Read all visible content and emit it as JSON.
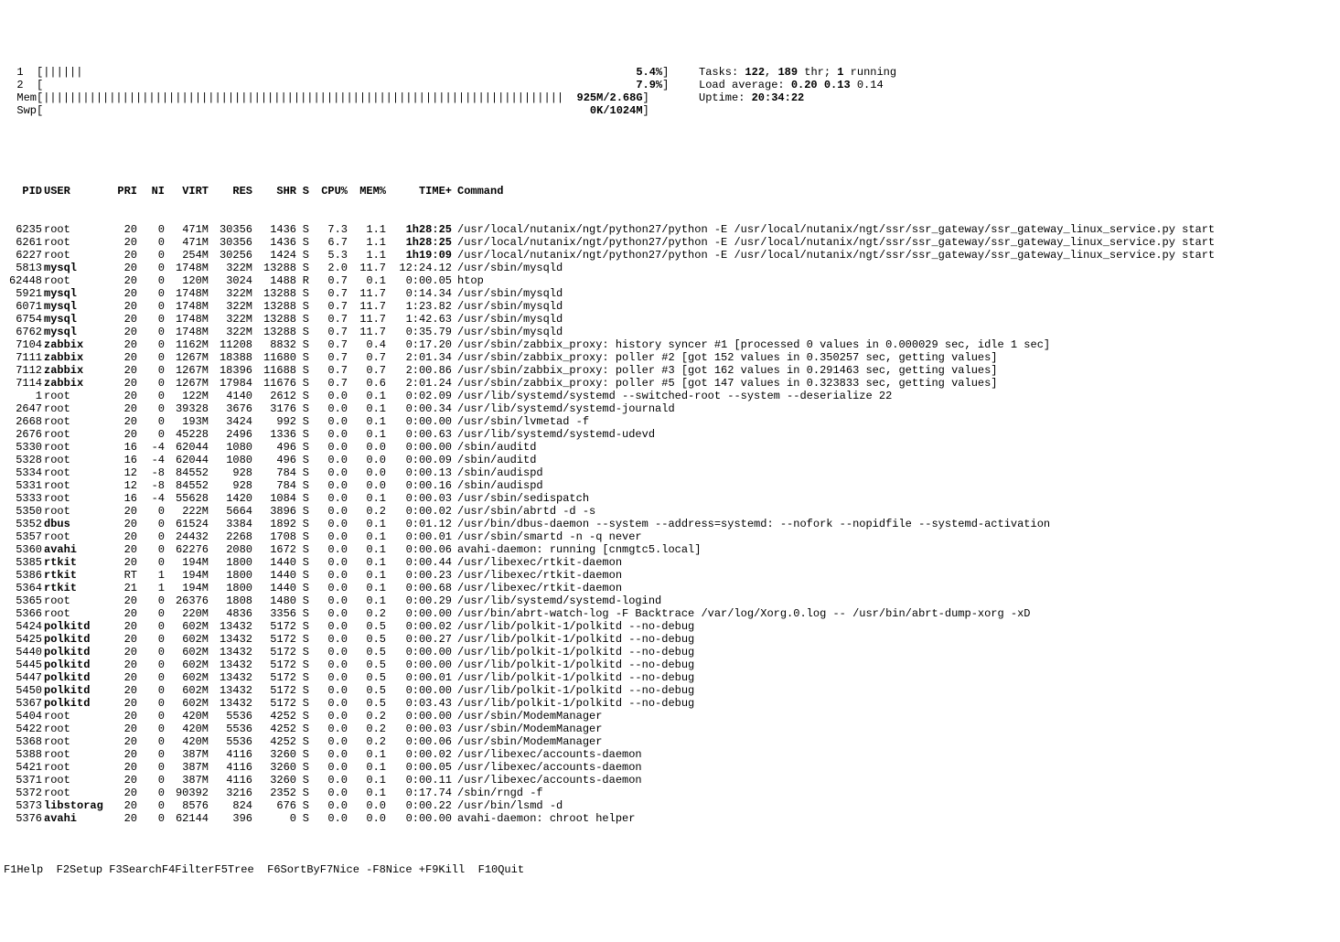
{
  "meters": {
    "cpu1": {
      "label": "  1  ",
      "bar": "[||||||                                                                                    ",
      "pct": "5.4%",
      "close": "]"
    },
    "cpu2": {
      "label": "  2  ",
      "bar": "[                                                                                          ",
      "pct": "7.9%",
      "close": "]"
    },
    "mem": {
      "label": "  Mem",
      "bar": "[|||||||||||||||||||||||||||||||||||||||||||||||||||||||||||||||||||||||||||||||  ",
      "val": "925M/2.68G",
      "close": "]"
    },
    "swp": {
      "label": "  Swp",
      "bar": "[                                                                                   ",
      "val": "0K/1024M",
      "close": "]"
    }
  },
  "stats": {
    "tasks_label": "Tasks: ",
    "tasks_a": "122",
    "tasks_sep1": ", ",
    "tasks_b": "189",
    "tasks_thr": " thr; ",
    "tasks_c": "1",
    "tasks_run": " running",
    "load_label": "Load average: ",
    "load_a": "0.20",
    "load_b": " 0.13",
    "load_c": " 0.14",
    "uptime_label": "Uptime: ",
    "uptime_val": "20:34:22"
  },
  "columns": [
    "PID",
    "USER",
    "PRI",
    "NI",
    "VIRT",
    "RES",
    "SHR",
    "S",
    "CPU%",
    "MEM%",
    "TIME+",
    "Command"
  ],
  "rows": [
    {
      "pid": "6235",
      "user": "root",
      "ub": false,
      "pri": "20",
      "ni": "0",
      "virt": "471M",
      "res": "30356",
      "shr": "1436",
      "s": "S",
      "cpu": "7.3",
      "mem": "1.1",
      "time": "1h28:25",
      "tb": true,
      "cmd": "/usr/local/nutanix/ngt/python27/python -E /usr/local/nutanix/ngt/ssr/ssr_gateway/ssr_gateway_linux_service.py start"
    },
    {
      "pid": "6261",
      "user": "root",
      "ub": false,
      "pri": "20",
      "ni": "0",
      "virt": "471M",
      "res": "30356",
      "shr": "1436",
      "s": "S",
      "cpu": "6.7",
      "mem": "1.1",
      "time": "1h28:25",
      "tb": true,
      "cmd": "/usr/local/nutanix/ngt/python27/python -E /usr/local/nutanix/ngt/ssr/ssr_gateway/ssr_gateway_linux_service.py start"
    },
    {
      "pid": "6227",
      "user": "root",
      "ub": false,
      "pri": "20",
      "ni": "0",
      "virt": "254M",
      "res": "30256",
      "shr": "1424",
      "s": "S",
      "cpu": "5.3",
      "mem": "1.1",
      "time": "1h19:09",
      "tb": true,
      "cmd": "/usr/local/nutanix/ngt/python27/python -E /usr/local/nutanix/ngt/ssr/ssr_gateway/ssr_gateway_linux_service.py start"
    },
    {
      "pid": "5813",
      "user": "mysql",
      "ub": true,
      "pri": "20",
      "ni": "0",
      "virt": "1748M",
      "res": "322M",
      "shr": "13288",
      "s": "S",
      "cpu": "2.0",
      "mem": "11.7",
      "time": "12:24.12",
      "tb": false,
      "cmd": "/usr/sbin/mysqld"
    },
    {
      "pid": "62448",
      "user": "root",
      "ub": false,
      "pri": "20",
      "ni": "0",
      "virt": "120M",
      "res": "3024",
      "shr": "1488",
      "s": "R",
      "cpu": "0.7",
      "mem": "0.1",
      "time": "0:00.05",
      "tb": false,
      "cmd": "htop"
    },
    {
      "pid": "5921",
      "user": "mysql",
      "ub": true,
      "pri": "20",
      "ni": "0",
      "virt": "1748M",
      "res": "322M",
      "shr": "13288",
      "s": "S",
      "cpu": "0.7",
      "mem": "11.7",
      "time": "0:14.34",
      "tb": false,
      "cmd": "/usr/sbin/mysqld"
    },
    {
      "pid": "6071",
      "user": "mysql",
      "ub": true,
      "pri": "20",
      "ni": "0",
      "virt": "1748M",
      "res": "322M",
      "shr": "13288",
      "s": "S",
      "cpu": "0.7",
      "mem": "11.7",
      "time": "1:23.82",
      "tb": false,
      "cmd": "/usr/sbin/mysqld"
    },
    {
      "pid": "6754",
      "user": "mysql",
      "ub": true,
      "pri": "20",
      "ni": "0",
      "virt": "1748M",
      "res": "322M",
      "shr": "13288",
      "s": "S",
      "cpu": "0.7",
      "mem": "11.7",
      "time": "1:42.63",
      "tb": false,
      "cmd": "/usr/sbin/mysqld"
    },
    {
      "pid": "6762",
      "user": "mysql",
      "ub": true,
      "pri": "20",
      "ni": "0",
      "virt": "1748M",
      "res": "322M",
      "shr": "13288",
      "s": "S",
      "cpu": "0.7",
      "mem": "11.7",
      "time": "0:35.79",
      "tb": false,
      "cmd": "/usr/sbin/mysqld"
    },
    {
      "pid": "7104",
      "user": "zabbix",
      "ub": true,
      "pri": "20",
      "ni": "0",
      "virt": "1162M",
      "res": "11208",
      "shr": "8832",
      "s": "S",
      "cpu": "0.7",
      "mem": "0.4",
      "time": "0:17.20",
      "tb": false,
      "cmd": "/usr/sbin/zabbix_proxy: history syncer #1 [processed 0 values in 0.000029 sec, idle 1 sec]"
    },
    {
      "pid": "7111",
      "user": "zabbix",
      "ub": true,
      "pri": "20",
      "ni": "0",
      "virt": "1267M",
      "res": "18388",
      "shr": "11680",
      "s": "S",
      "cpu": "0.7",
      "mem": "0.7",
      "time": "2:01.34",
      "tb": false,
      "cmd": "/usr/sbin/zabbix_proxy: poller #2 [got 152 values in 0.350257 sec, getting values]"
    },
    {
      "pid": "7112",
      "user": "zabbix",
      "ub": true,
      "pri": "20",
      "ni": "0",
      "virt": "1267M",
      "res": "18396",
      "shr": "11688",
      "s": "S",
      "cpu": "0.7",
      "mem": "0.7",
      "time": "2:00.86",
      "tb": false,
      "cmd": "/usr/sbin/zabbix_proxy: poller #3 [got 162 values in 0.291463 sec, getting values]"
    },
    {
      "pid": "7114",
      "user": "zabbix",
      "ub": true,
      "pri": "20",
      "ni": "0",
      "virt": "1267M",
      "res": "17984",
      "shr": "11676",
      "s": "S",
      "cpu": "0.7",
      "mem": "0.6",
      "time": "2:01.24",
      "tb": false,
      "cmd": "/usr/sbin/zabbix_proxy: poller #5 [got 147 values in 0.323833 sec, getting values]"
    },
    {
      "pid": "1",
      "user": "root",
      "ub": false,
      "pri": "20",
      "ni": "0",
      "virt": "122M",
      "res": "4140",
      "shr": "2612",
      "s": "S",
      "cpu": "0.0",
      "mem": "0.1",
      "time": "0:02.09",
      "tb": false,
      "cmd": "/usr/lib/systemd/systemd --switched-root --system --deserialize 22"
    },
    {
      "pid": "2647",
      "user": "root",
      "ub": false,
      "pri": "20",
      "ni": "0",
      "virt": "39328",
      "res": "3676",
      "shr": "3176",
      "s": "S",
      "cpu": "0.0",
      "mem": "0.1",
      "time": "0:00.34",
      "tb": false,
      "cmd": "/usr/lib/systemd/systemd-journald"
    },
    {
      "pid": "2668",
      "user": "root",
      "ub": false,
      "pri": "20",
      "ni": "0",
      "virt": "193M",
      "res": "3424",
      "shr": "992",
      "s": "S",
      "cpu": "0.0",
      "mem": "0.1",
      "time": "0:00.00",
      "tb": false,
      "cmd": "/usr/sbin/lvmetad -f"
    },
    {
      "pid": "2676",
      "user": "root",
      "ub": false,
      "pri": "20",
      "ni": "0",
      "virt": "45228",
      "res": "2496",
      "shr": "1336",
      "s": "S",
      "cpu": "0.0",
      "mem": "0.1",
      "time": "0:00.63",
      "tb": false,
      "cmd": "/usr/lib/systemd/systemd-udevd"
    },
    {
      "pid": "5330",
      "user": "root",
      "ub": false,
      "pri": "16",
      "ni": "-4",
      "virt": "62044",
      "res": "1080",
      "shr": "496",
      "s": "S",
      "cpu": "0.0",
      "mem": "0.0",
      "time": "0:00.00",
      "tb": false,
      "cmd": "/sbin/auditd"
    },
    {
      "pid": "5328",
      "user": "root",
      "ub": false,
      "pri": "16",
      "ni": "-4",
      "virt": "62044",
      "res": "1080",
      "shr": "496",
      "s": "S",
      "cpu": "0.0",
      "mem": "0.0",
      "time": "0:00.09",
      "tb": false,
      "cmd": "/sbin/auditd"
    },
    {
      "pid": "5334",
      "user": "root",
      "ub": false,
      "pri": "12",
      "ni": "-8",
      "virt": "84552",
      "res": "928",
      "shr": "784",
      "s": "S",
      "cpu": "0.0",
      "mem": "0.0",
      "time": "0:00.13",
      "tb": false,
      "cmd": "/sbin/audispd"
    },
    {
      "pid": "5331",
      "user": "root",
      "ub": false,
      "pri": "12",
      "ni": "-8",
      "virt": "84552",
      "res": "928",
      "shr": "784",
      "s": "S",
      "cpu": "0.0",
      "mem": "0.0",
      "time": "0:00.16",
      "tb": false,
      "cmd": "/sbin/audispd"
    },
    {
      "pid": "5333",
      "user": "root",
      "ub": false,
      "pri": "16",
      "ni": "-4",
      "virt": "55628",
      "res": "1420",
      "shr": "1084",
      "s": "S",
      "cpu": "0.0",
      "mem": "0.1",
      "time": "0:00.03",
      "tb": false,
      "cmd": "/usr/sbin/sedispatch"
    },
    {
      "pid": "5350",
      "user": "root",
      "ub": false,
      "pri": "20",
      "ni": "0",
      "virt": "222M",
      "res": "5664",
      "shr": "3896",
      "s": "S",
      "cpu": "0.0",
      "mem": "0.2",
      "time": "0:00.02",
      "tb": false,
      "cmd": "/usr/sbin/abrtd -d -s"
    },
    {
      "pid": "5352",
      "user": "dbus",
      "ub": true,
      "pri": "20",
      "ni": "0",
      "virt": "61524",
      "res": "3384",
      "shr": "1892",
      "s": "S",
      "cpu": "0.0",
      "mem": "0.1",
      "time": "0:01.12",
      "tb": false,
      "cmd": "/usr/bin/dbus-daemon --system --address=systemd: --nofork --nopidfile --systemd-activation"
    },
    {
      "pid": "5357",
      "user": "root",
      "ub": false,
      "pri": "20",
      "ni": "0",
      "virt": "24432",
      "res": "2268",
      "shr": "1708",
      "s": "S",
      "cpu": "0.0",
      "mem": "0.1",
      "time": "0:00.01",
      "tb": false,
      "cmd": "/usr/sbin/smartd -n -q never"
    },
    {
      "pid": "5360",
      "user": "avahi",
      "ub": true,
      "pri": "20",
      "ni": "0",
      "virt": "62276",
      "res": "2080",
      "shr": "1672",
      "s": "S",
      "cpu": "0.0",
      "mem": "0.1",
      "time": "0:00.06",
      "tb": false,
      "cmd": "avahi-daemon: running [cnmgtc5.local]"
    },
    {
      "pid": "5385",
      "user": "rtkit",
      "ub": true,
      "pri": "20",
      "ni": "0",
      "virt": "194M",
      "res": "1800",
      "shr": "1440",
      "s": "S",
      "cpu": "0.0",
      "mem": "0.1",
      "time": "0:00.44",
      "tb": false,
      "cmd": "/usr/libexec/rtkit-daemon"
    },
    {
      "pid": "5386",
      "user": "rtkit",
      "ub": true,
      "pri": "RT",
      "ni": "1",
      "virt": "194M",
      "res": "1800",
      "shr": "1440",
      "s": "S",
      "cpu": "0.0",
      "mem": "0.1",
      "time": "0:00.23",
      "tb": false,
      "cmd": "/usr/libexec/rtkit-daemon"
    },
    {
      "pid": "5364",
      "user": "rtkit",
      "ub": true,
      "pri": "21",
      "ni": "1",
      "virt": "194M",
      "res": "1800",
      "shr": "1440",
      "s": "S",
      "cpu": "0.0",
      "mem": "0.1",
      "time": "0:00.68",
      "tb": false,
      "cmd": "/usr/libexec/rtkit-daemon"
    },
    {
      "pid": "5365",
      "user": "root",
      "ub": false,
      "pri": "20",
      "ni": "0",
      "virt": "26376",
      "res": "1808",
      "shr": "1480",
      "s": "S",
      "cpu": "0.0",
      "mem": "0.1",
      "time": "0:00.29",
      "tb": false,
      "cmd": "/usr/lib/systemd/systemd-logind"
    },
    {
      "pid": "5366",
      "user": "root",
      "ub": false,
      "pri": "20",
      "ni": "0",
      "virt": "220M",
      "res": "4836",
      "shr": "3356",
      "s": "S",
      "cpu": "0.0",
      "mem": "0.2",
      "time": "0:00.00",
      "tb": false,
      "cmd": "/usr/bin/abrt-watch-log -F Backtrace /var/log/Xorg.0.log -- /usr/bin/abrt-dump-xorg -xD"
    },
    {
      "pid": "5424",
      "user": "polkitd",
      "ub": true,
      "pri": "20",
      "ni": "0",
      "virt": "602M",
      "res": "13432",
      "shr": "5172",
      "s": "S",
      "cpu": "0.0",
      "mem": "0.5",
      "time": "0:00.02",
      "tb": false,
      "cmd": "/usr/lib/polkit-1/polkitd --no-debug"
    },
    {
      "pid": "5425",
      "user": "polkitd",
      "ub": true,
      "pri": "20",
      "ni": "0",
      "virt": "602M",
      "res": "13432",
      "shr": "5172",
      "s": "S",
      "cpu": "0.0",
      "mem": "0.5",
      "time": "0:00.27",
      "tb": false,
      "cmd": "/usr/lib/polkit-1/polkitd --no-debug"
    },
    {
      "pid": "5440",
      "user": "polkitd",
      "ub": true,
      "pri": "20",
      "ni": "0",
      "virt": "602M",
      "res": "13432",
      "shr": "5172",
      "s": "S",
      "cpu": "0.0",
      "mem": "0.5",
      "time": "0:00.00",
      "tb": false,
      "cmd": "/usr/lib/polkit-1/polkitd --no-debug"
    },
    {
      "pid": "5445",
      "user": "polkitd",
      "ub": true,
      "pri": "20",
      "ni": "0",
      "virt": "602M",
      "res": "13432",
      "shr": "5172",
      "s": "S",
      "cpu": "0.0",
      "mem": "0.5",
      "time": "0:00.00",
      "tb": false,
      "cmd": "/usr/lib/polkit-1/polkitd --no-debug"
    },
    {
      "pid": "5447",
      "user": "polkitd",
      "ub": true,
      "pri": "20",
      "ni": "0",
      "virt": "602M",
      "res": "13432",
      "shr": "5172",
      "s": "S",
      "cpu": "0.0",
      "mem": "0.5",
      "time": "0:00.01",
      "tb": false,
      "cmd": "/usr/lib/polkit-1/polkitd --no-debug"
    },
    {
      "pid": "5450",
      "user": "polkitd",
      "ub": true,
      "pri": "20",
      "ni": "0",
      "virt": "602M",
      "res": "13432",
      "shr": "5172",
      "s": "S",
      "cpu": "0.0",
      "mem": "0.5",
      "time": "0:00.00",
      "tb": false,
      "cmd": "/usr/lib/polkit-1/polkitd --no-debug"
    },
    {
      "pid": "5367",
      "user": "polkitd",
      "ub": true,
      "pri": "20",
      "ni": "0",
      "virt": "602M",
      "res": "13432",
      "shr": "5172",
      "s": "S",
      "cpu": "0.0",
      "mem": "0.5",
      "time": "0:03.43",
      "tb": false,
      "cmd": "/usr/lib/polkit-1/polkitd --no-debug"
    },
    {
      "pid": "5404",
      "user": "root",
      "ub": false,
      "pri": "20",
      "ni": "0",
      "virt": "420M",
      "res": "5536",
      "shr": "4252",
      "s": "S",
      "cpu": "0.0",
      "mem": "0.2",
      "time": "0:00.00",
      "tb": false,
      "cmd": "/usr/sbin/ModemManager"
    },
    {
      "pid": "5422",
      "user": "root",
      "ub": false,
      "pri": "20",
      "ni": "0",
      "virt": "420M",
      "res": "5536",
      "shr": "4252",
      "s": "S",
      "cpu": "0.0",
      "mem": "0.2",
      "time": "0:00.03",
      "tb": false,
      "cmd": "/usr/sbin/ModemManager"
    },
    {
      "pid": "5368",
      "user": "root",
      "ub": false,
      "pri": "20",
      "ni": "0",
      "virt": "420M",
      "res": "5536",
      "shr": "4252",
      "s": "S",
      "cpu": "0.0",
      "mem": "0.2",
      "time": "0:00.06",
      "tb": false,
      "cmd": "/usr/sbin/ModemManager"
    },
    {
      "pid": "5388",
      "user": "root",
      "ub": false,
      "pri": "20",
      "ni": "0",
      "virt": "387M",
      "res": "4116",
      "shr": "3260",
      "s": "S",
      "cpu": "0.0",
      "mem": "0.1",
      "time": "0:00.02",
      "tb": false,
      "cmd": "/usr/libexec/accounts-daemon"
    },
    {
      "pid": "5421",
      "user": "root",
      "ub": false,
      "pri": "20",
      "ni": "0",
      "virt": "387M",
      "res": "4116",
      "shr": "3260",
      "s": "S",
      "cpu": "0.0",
      "mem": "0.1",
      "time": "0:00.05",
      "tb": false,
      "cmd": "/usr/libexec/accounts-daemon"
    },
    {
      "pid": "5371",
      "user": "root",
      "ub": false,
      "pri": "20",
      "ni": "0",
      "virt": "387M",
      "res": "4116",
      "shr": "3260",
      "s": "S",
      "cpu": "0.0",
      "mem": "0.1",
      "time": "0:00.11",
      "tb": false,
      "cmd": "/usr/libexec/accounts-daemon"
    },
    {
      "pid": "5372",
      "user": "root",
      "ub": false,
      "pri": "20",
      "ni": "0",
      "virt": "90392",
      "res": "3216",
      "shr": "2352",
      "s": "S",
      "cpu": "0.0",
      "mem": "0.1",
      "time": "0:17.74",
      "tb": false,
      "cmd": "/sbin/rngd -f"
    },
    {
      "pid": "5373",
      "user": "libstorag",
      "ub": true,
      "pri": "20",
      "ni": "0",
      "virt": "8576",
      "res": "824",
      "shr": "676",
      "s": "S",
      "cpu": "0.0",
      "mem": "0.0",
      "time": "0:00.22",
      "tb": false,
      "cmd": "/usr/bin/lsmd -d"
    },
    {
      "pid": "5376",
      "user": "avahi",
      "ub": true,
      "pri": "20",
      "ni": "0",
      "virt": "62144",
      "res": "396",
      "shr": "0",
      "s": "S",
      "cpu": "0.0",
      "mem": "0.0",
      "time": "0:00.00",
      "tb": false,
      "cmd": "avahi-daemon: chroot helper"
    }
  ],
  "footer": [
    {
      "k": "F1",
      "l": "Help  "
    },
    {
      "k": "F2",
      "l": "Setup "
    },
    {
      "k": "F3",
      "l": "Search"
    },
    {
      "k": "F4",
      "l": "Filter"
    },
    {
      "k": "F5",
      "l": "Tree  "
    },
    {
      "k": "F6",
      "l": "SortBy"
    },
    {
      "k": "F7",
      "l": "Nice -"
    },
    {
      "k": "F8",
      "l": "Nice +"
    },
    {
      "k": "F9",
      "l": "Kill  "
    },
    {
      "k": "F10",
      "l": "Quit  "
    }
  ]
}
